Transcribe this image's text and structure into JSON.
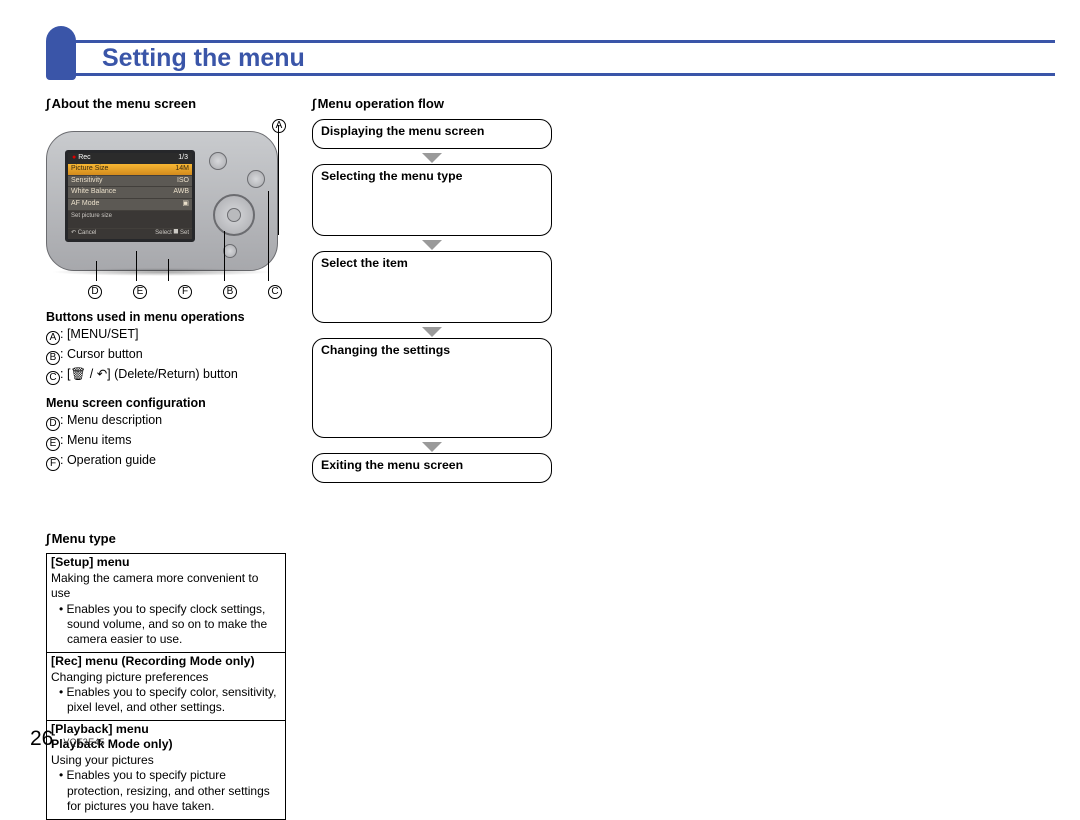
{
  "title": "Setting the menu",
  "left": {
    "about_heading": "About the menu screen",
    "buttons_heading": "Buttons used in menu operations",
    "labels": {
      "A": "A",
      "B": "B",
      "C": "C",
      "D": "D",
      "E": "E",
      "F": "F"
    },
    "btn_A": ": [MENU/SET]",
    "btn_B": ": Cursor button",
    "btn_C": ": [🗑 / ↶] (Delete/Return) button",
    "config_heading": "Menu screen configuration",
    "cfg_D": ": Menu description",
    "cfg_E": ": Menu items",
    "cfg_F": ": Operation guide",
    "lcd": {
      "rec": "Rec",
      "page": "1/3",
      "r1": "Picture Size",
      "r1v": "14M",
      "r2": "Sensitivity",
      "r2v": "ISO",
      "r3": "White Balance",
      "r3v": "AWB",
      "r4": "AF Mode",
      "r4v": "▣",
      "desc": "Set picture size",
      "fL": "↶ Cancel",
      "fR": "Select ⯀ Set"
    }
  },
  "menu_type": {
    "heading": "Menu type",
    "rows": [
      {
        "title": "[Setup] menu",
        "sub": "Making the camera more convenient to use",
        "bullet": "Enables you to specify clock settings, sound volume, and so on to make the camera easier to use."
      },
      {
        "title": "[Rec] menu (Recording Mode only)",
        "sub": "Changing picture preferences",
        "bullet": "Enables you to specify color, sensitivity, pixel level, and other settings."
      },
      {
        "title": "[Playback] menu",
        "title2": "Playback Mode only)",
        "sub": "Using your pictures",
        "bullet": "Enables you to specify picture protection, resizing, and other settings for pictures you have taken."
      }
    ]
  },
  "flow": {
    "heading": "Menu operation flow",
    "steps": [
      "Displaying the menu screen",
      "Selecting the menu type",
      "Select the item",
      "Changing the settings",
      "Exiting the menu screen"
    ]
  },
  "footer": {
    "page": "26",
    "doc": "VQT3E45"
  }
}
